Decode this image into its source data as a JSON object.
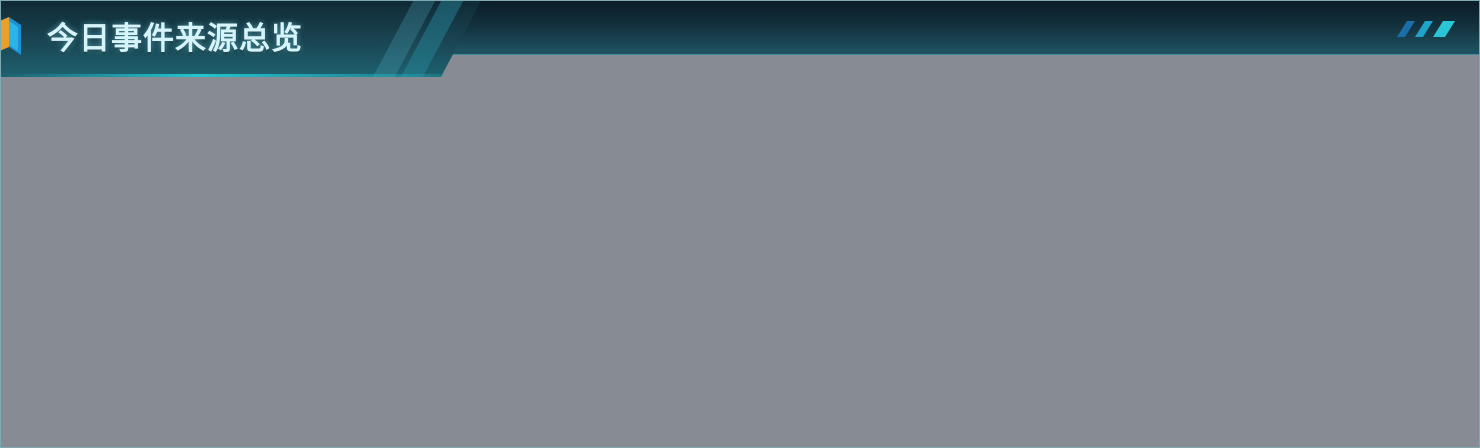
{
  "panel": {
    "title": "今日事件来源总览",
    "title_icon": "cube-icon",
    "corner_decoration": "slash-stripes-icon"
  },
  "colors": {
    "header_dark": "#0b1c27",
    "header_teal": "#1f5362",
    "accent_cyan": "#23c4cf",
    "title_text": "#d8f4fb",
    "body_background": "#878c94",
    "icon_orange": "#e8a02a",
    "icon_blue": "#1f8fd6"
  }
}
